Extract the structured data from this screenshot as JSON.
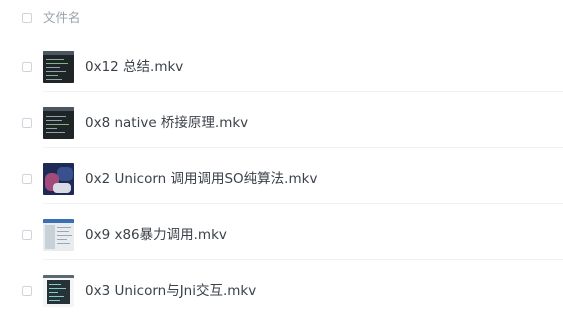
{
  "header": {
    "column_label": "文件名"
  },
  "files": [
    {
      "name": "0x12 总结.mkv",
      "thumbnail": "video-thumbnail-dark-terminal"
    },
    {
      "name": "0x8 native 桥接原理.mkv",
      "thumbnail": "video-thumbnail-dark-terminal"
    },
    {
      "name": "0x2 Unicorn 调用调用SO纯算法.mkv",
      "thumbnail": "video-thumbnail-unicorn-art"
    },
    {
      "name": "0x9 x86暴力调用.mkv",
      "thumbnail": "video-thumbnail-light-window"
    },
    {
      "name": "0x3 Unicorn与Jni交互.mkv",
      "thumbnail": "video-thumbnail-code-editor"
    }
  ],
  "colors": {
    "text": "#3b4249",
    "header_text": "#9aa1a8",
    "divider": "#f1f2f4",
    "checkbox_border": "#cfd4d9"
  }
}
